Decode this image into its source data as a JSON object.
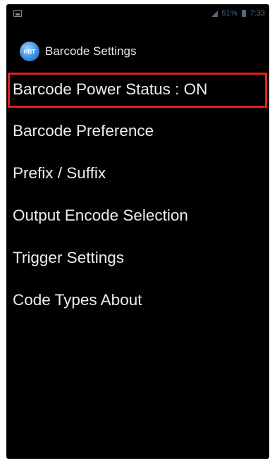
{
  "status_bar": {
    "left_icon": "image-notification-icon",
    "right_text": "51%",
    "time": "7:33",
    "signal_icon": "signal-icon",
    "battery_icon": "battery-icon"
  },
  "action_bar": {
    "app_icon": "barcode-app-icon",
    "app_icon_text": "HBT",
    "title": "Barcode Settings"
  },
  "menu": {
    "items": [
      {
        "label": "Barcode Power Status : ON",
        "highlighted": true
      },
      {
        "label": "Barcode Preference"
      },
      {
        "label": "Prefix / Suffix"
      },
      {
        "label": "Output Encode Selection"
      },
      {
        "label": "Trigger Settings"
      },
      {
        "label": "Code Types About"
      }
    ]
  },
  "colors": {
    "background": "#000000",
    "text": "#ededed",
    "highlight_border": "#e02020",
    "status_icons": "#6f8aa6"
  }
}
